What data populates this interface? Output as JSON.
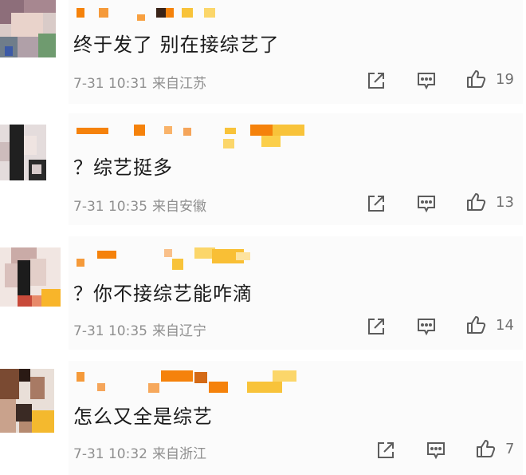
{
  "comments": [
    {
      "text": "终于发了 别在接综艺了",
      "date": "7-31 10:31",
      "location": "来自江苏",
      "likes": "19"
    },
    {
      "text": "？综艺挺多",
      "date": "7-31 10:35",
      "location": "来自安徽",
      "likes": "13"
    },
    {
      "text": "？你不接综艺能咋滴",
      "date": "7-31 10:35",
      "location": "来自辽宁",
      "likes": "14"
    },
    {
      "text": "怎么又全是综艺",
      "date": "7-31 10:32",
      "location": "来自浙江",
      "likes": "7"
    }
  ],
  "icons": {
    "share": "share-icon",
    "comment": "comment-icon",
    "like": "thumbs-up-icon"
  },
  "colors": {
    "text": "#1a1a1a",
    "meta": "#8f8f8f",
    "icon": "#5c5c5c",
    "blur_orange": "#f5820b",
    "blur_yellow": "#f8c33a"
  }
}
